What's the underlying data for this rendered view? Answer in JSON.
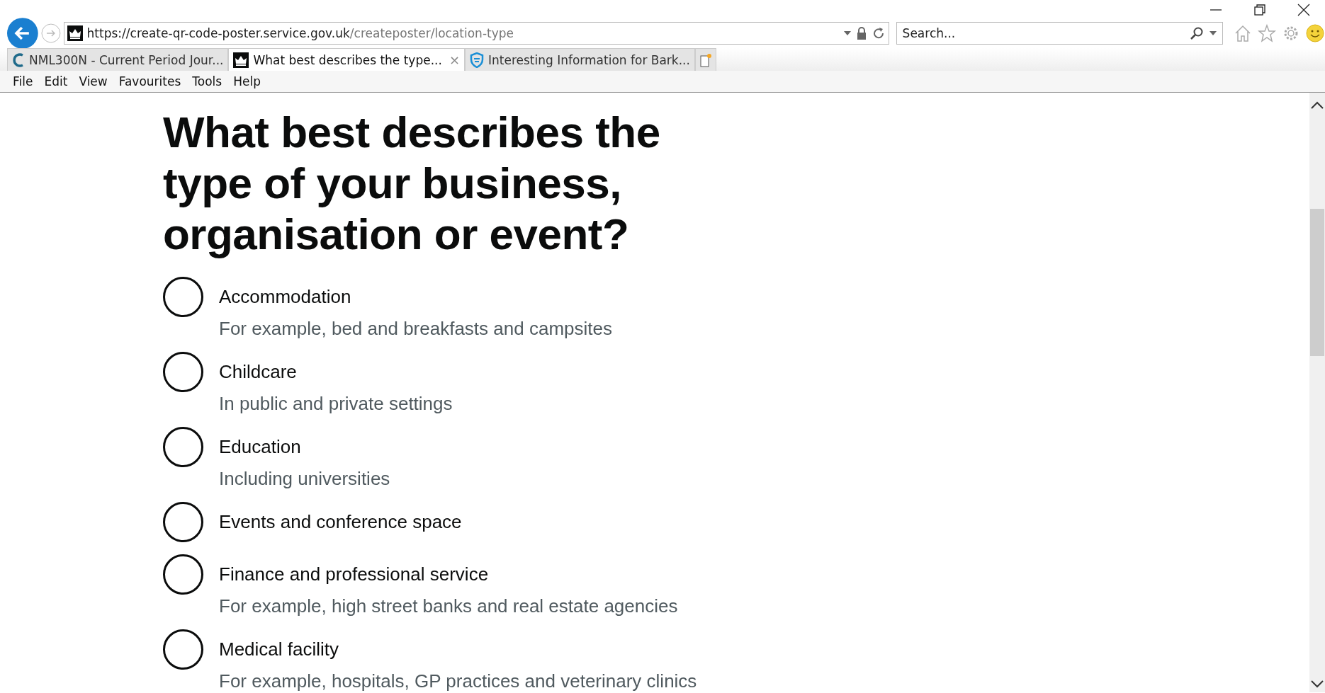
{
  "browser": {
    "address": {
      "host": "https://create-qr-code-poster.service.gov.uk",
      "path": "/createposter/location-type"
    },
    "search": {
      "placeholder": "Search..."
    },
    "tabs": [
      {
        "title": "NML300N - Current Period Jour...",
        "kind": "letter",
        "selected": false
      },
      {
        "title": "What best describes the type...",
        "kind": "crown",
        "selected": true,
        "close": "×"
      },
      {
        "title": "Interesting Information for Bark...",
        "kind": "shield",
        "selected": false
      }
    ],
    "menu": [
      "File",
      "Edit",
      "View",
      "Favourites",
      "Tools",
      "Help"
    ]
  },
  "page": {
    "heading": "What best describes the type of your business, organisation or event?",
    "options": [
      {
        "label": "Accommodation",
        "hint": "For example, bed and breakfasts and campsites",
        "selected": false
      },
      {
        "label": "Childcare",
        "hint": "In public and private settings",
        "selected": false
      },
      {
        "label": "Education",
        "hint": "Including universities",
        "selected": false
      },
      {
        "label": "Events and conference space",
        "selected": false
      },
      {
        "label": "Finance and professional service",
        "hint": "For example, high street banks and real estate agencies",
        "selected": false
      },
      {
        "label": "Medical facility",
        "hint": "For example, hospitals, GP practices and veterinary clinics",
        "selected": false
      }
    ]
  }
}
